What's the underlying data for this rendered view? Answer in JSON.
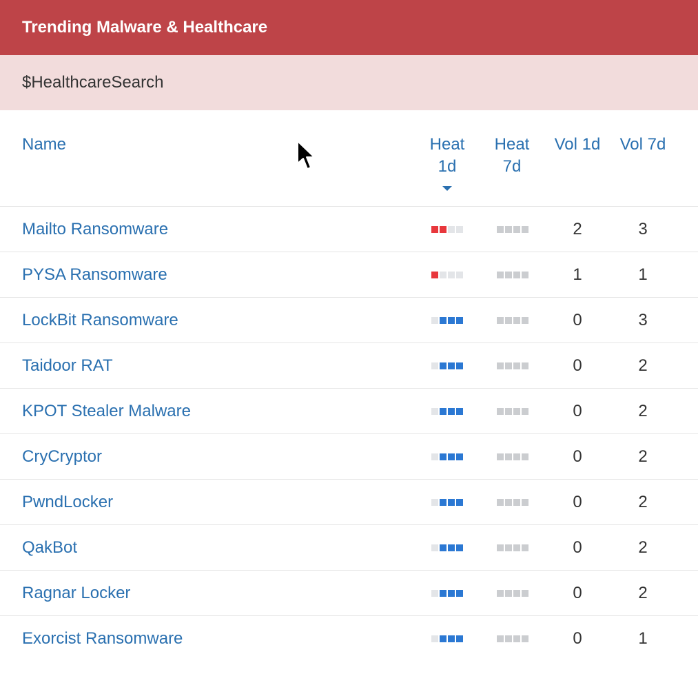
{
  "header": {
    "title": "Trending Malware & Healthcare"
  },
  "subheader": {
    "search_name": "$HealthcareSearch"
  },
  "columns": {
    "name": "Name",
    "heat_1d_line1": "Heat",
    "heat_1d_line2": "1d",
    "heat_7d_line1": "Heat",
    "heat_7d_line2": "7d",
    "vol_1d": "Vol 1d",
    "vol_7d": "Vol 7d",
    "sorted_by": "heat_1d",
    "sort_direction": "descending"
  },
  "colors": {
    "header_bg": "#be4448",
    "subheader_bg": "#f2dcdc",
    "link": "#2a70b0",
    "heat_red": "#e8373c",
    "heat_blue": "#2b78d3",
    "heat_grey": "#cbcdd0"
  },
  "rows": [
    {
      "name": "Mailto Ransomware",
      "heat_1d": [
        "red",
        "red",
        "empty",
        "empty"
      ],
      "heat_7d": [
        "grey",
        "grey",
        "grey",
        "grey"
      ],
      "vol_1d": "2",
      "vol_7d": "3"
    },
    {
      "name": "PYSA Ransomware",
      "heat_1d": [
        "red",
        "empty",
        "empty",
        "empty"
      ],
      "heat_7d": [
        "grey",
        "grey",
        "grey",
        "grey"
      ],
      "vol_1d": "1",
      "vol_7d": "1"
    },
    {
      "name": "LockBit Ransomware",
      "heat_1d": [
        "empty",
        "blue",
        "blue",
        "blue"
      ],
      "heat_7d": [
        "grey",
        "grey",
        "grey",
        "grey"
      ],
      "vol_1d": "0",
      "vol_7d": "3"
    },
    {
      "name": "Taidoor RAT",
      "heat_1d": [
        "empty",
        "blue",
        "blue",
        "blue"
      ],
      "heat_7d": [
        "grey",
        "grey",
        "grey",
        "grey"
      ],
      "vol_1d": "0",
      "vol_7d": "2"
    },
    {
      "name": "KPOT Stealer Malware",
      "heat_1d": [
        "empty",
        "blue",
        "blue",
        "blue"
      ],
      "heat_7d": [
        "grey",
        "grey",
        "grey",
        "grey"
      ],
      "vol_1d": "0",
      "vol_7d": "2"
    },
    {
      "name": "CryCryptor",
      "heat_1d": [
        "empty",
        "blue",
        "blue",
        "blue"
      ],
      "heat_7d": [
        "grey",
        "grey",
        "grey",
        "grey"
      ],
      "vol_1d": "0",
      "vol_7d": "2"
    },
    {
      "name": "PwndLocker",
      "heat_1d": [
        "empty",
        "blue",
        "blue",
        "blue"
      ],
      "heat_7d": [
        "grey",
        "grey",
        "grey",
        "grey"
      ],
      "vol_1d": "0",
      "vol_7d": "2"
    },
    {
      "name": "QakBot",
      "heat_1d": [
        "empty",
        "blue",
        "blue",
        "blue"
      ],
      "heat_7d": [
        "grey",
        "grey",
        "grey",
        "grey"
      ],
      "vol_1d": "0",
      "vol_7d": "2"
    },
    {
      "name": "Ragnar Locker",
      "heat_1d": [
        "empty",
        "blue",
        "blue",
        "blue"
      ],
      "heat_7d": [
        "grey",
        "grey",
        "grey",
        "grey"
      ],
      "vol_1d": "0",
      "vol_7d": "2"
    },
    {
      "name": "Exorcist Ransomware",
      "heat_1d": [
        "empty",
        "blue",
        "blue",
        "blue"
      ],
      "heat_7d": [
        "grey",
        "grey",
        "grey",
        "grey"
      ],
      "vol_1d": "0",
      "vol_7d": "1"
    }
  ]
}
